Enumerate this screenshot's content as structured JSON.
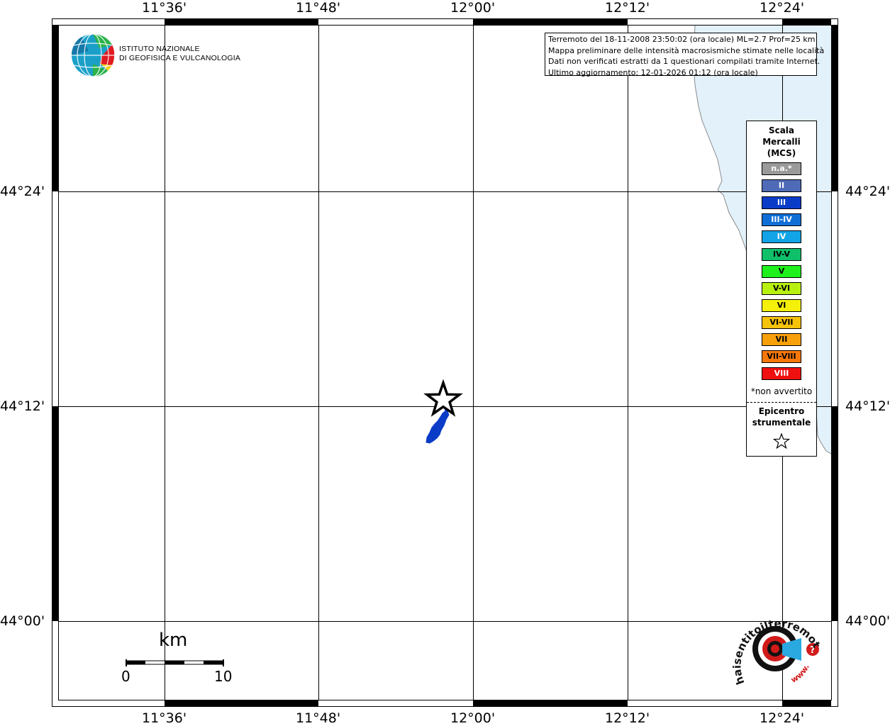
{
  "map": {
    "lon_labels": [
      "11°36'",
      "11°48'",
      "12°00'",
      "12°12'",
      "12°24'"
    ],
    "lat_labels": [
      "44°24'",
      "44°12'",
      "44°00'"
    ]
  },
  "logo": {
    "line1": "ISTITUTO NAZIONALE",
    "line2": "DI GEOFISICA E VULCANOLOGIA"
  },
  "info": {
    "line1": "Terremoto del 18-11-2008 23:50:02 (ora locale) ML=2.7 Prof=25 km",
    "line2": "Mappa preliminare delle intensità macrosismiche stimate nelle località",
    "line3": "Dati non verificati estratti da 1 questionari compilati tramite Internet.",
    "line4": "Ultimo aggiornamento: 12-01-2026 01:12 (ora locale)"
  },
  "legend": {
    "title1": "Scala",
    "title2": "Mercalli",
    "title3": "(MCS)",
    "items": [
      {
        "label": "n.a.*",
        "color": "#9a9a9a",
        "text_color": "#ffffff"
      },
      {
        "label": "II",
        "color": "#4f6bb8",
        "text_color": "#ffffff"
      },
      {
        "label": "III",
        "color": "#0a3cc8",
        "text_color": "#ffffff"
      },
      {
        "label": "III-IV",
        "color": "#0f6fd6",
        "text_color": "#ffffff"
      },
      {
        "label": "IV",
        "color": "#12a4e6",
        "text_color": "#ffffff"
      },
      {
        "label": "IV-V",
        "color": "#0fbf6a",
        "text_color": "#000000"
      },
      {
        "label": "V",
        "color": "#1df01d",
        "text_color": "#000000"
      },
      {
        "label": "V-VI",
        "color": "#b8f00f",
        "text_color": "#000000"
      },
      {
        "label": "VI",
        "color": "#f5f00a",
        "text_color": "#000000"
      },
      {
        "label": "VI-VII",
        "color": "#f7c20a",
        "text_color": "#000000"
      },
      {
        "label": "VII",
        "color": "#f7a00a",
        "text_color": "#000000"
      },
      {
        "label": "VII-VIII",
        "color": "#f7780a",
        "text_color": "#000000"
      },
      {
        "label": "VIII",
        "color": "#f01010",
        "text_color": "#ffffff"
      }
    ],
    "note": "*non avvertito",
    "epicenter1": "Epicentro",
    "epicenter2": "strumentale"
  },
  "scale_bar": {
    "unit": "km",
    "start": "0",
    "end": "10"
  },
  "brand": {
    "text": "haisentitoilterremoto.it",
    "www": "www."
  },
  "colors": {
    "sea": "#e3f1fb",
    "coast": "#8a8a8a",
    "intensity_area": "#0a3cc8"
  }
}
